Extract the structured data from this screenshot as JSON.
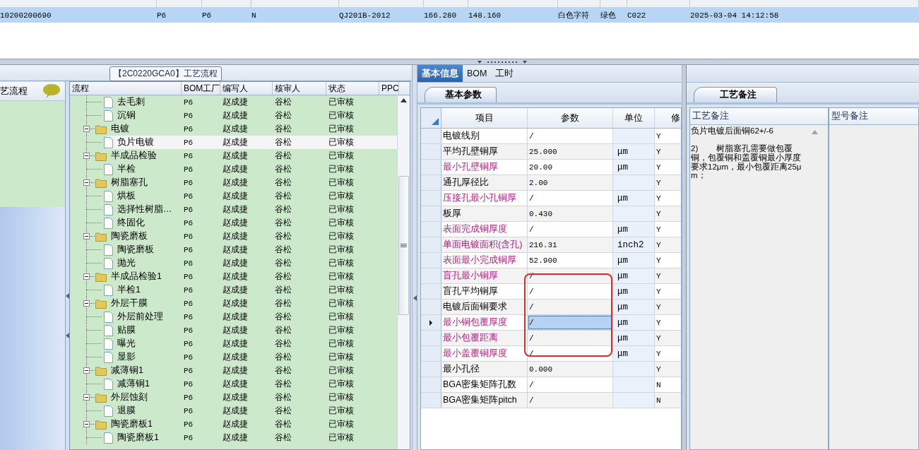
{
  "top_table": {
    "rows": [
      {
        "selected": true,
        "cells": [
          "10200200690",
          "P6",
          "P6",
          "N",
          "QJ201B-2012",
          "166.280",
          "148.160",
          "白色字符",
          "绿色",
          "C022",
          "2025-03-04 14:12:58"
        ]
      }
    ]
  },
  "sidebar": {
    "title": "艺流程"
  },
  "process_group": {
    "title": "【2C0220GCA0】工艺流程"
  },
  "tree": {
    "columns": [
      "流程",
      "BOM工厂",
      "编写人",
      "核审人",
      "状态",
      "PPC"
    ],
    "items": [
      {
        "children": [
          {
            "label": "去毛刺",
            "kind": "file",
            "selected": false,
            "bom": "P6",
            "author": "赵成捷",
            "reviewer": "谷松",
            "status": "已审核"
          },
          {
            "label": "沉铜",
            "kind": "file",
            "selected": false,
            "bom": "P6",
            "author": "赵成捷",
            "reviewer": "谷松",
            "status": "已审核"
          }
        ]
      },
      {
        "label": "电镀",
        "kind": "folder",
        "expanded": true,
        "selected": false,
        "bom": "P6",
        "author": "赵成捷",
        "reviewer": "谷松",
        "status": "已审核",
        "children": [
          {
            "label": "负片电镀",
            "kind": "file",
            "selected": true,
            "bom": "P6",
            "author": "赵成捷",
            "reviewer": "谷松",
            "status": "已审核"
          }
        ]
      },
      {
        "label": "半成品检验",
        "kind": "folder",
        "expanded": true,
        "selected": false,
        "bom": "P6",
        "author": "赵成捷",
        "reviewer": "谷松",
        "status": "已审核",
        "children": [
          {
            "label": "半检",
            "kind": "file",
            "selected": false,
            "bom": "P6",
            "author": "赵成捷",
            "reviewer": "谷松",
            "status": "已审核"
          }
        ]
      },
      {
        "label": "树脂塞孔",
        "kind": "folder",
        "expanded": true,
        "selected": false,
        "bom": "P6",
        "author": "赵成捷",
        "reviewer": "谷松",
        "status": "已审核",
        "children": [
          {
            "label": "烘板",
            "kind": "file",
            "selected": false,
            "bom": "P6",
            "author": "赵成捷",
            "reviewer": "谷松",
            "status": "已审核"
          },
          {
            "label": "选择性树脂…",
            "kind": "file",
            "selected": false,
            "bom": "P6",
            "author": "赵成捷",
            "reviewer": "谷松",
            "status": "已审核"
          },
          {
            "label": "终固化",
            "kind": "file",
            "selected": false,
            "bom": "P6",
            "author": "赵成捷",
            "reviewer": "谷松",
            "status": "已审核"
          }
        ]
      },
      {
        "label": "陶瓷磨板",
        "kind": "folder",
        "expanded": true,
        "selected": false,
        "bom": "P6",
        "author": "赵成捷",
        "reviewer": "谷松",
        "status": "已审核",
        "children": [
          {
            "label": "陶瓷磨板",
            "kind": "file",
            "selected": false,
            "bom": "P6",
            "author": "赵成捷",
            "reviewer": "谷松",
            "status": "已审核"
          },
          {
            "label": "抛光",
            "kind": "file",
            "selected": false,
            "bom": "P6",
            "author": "赵成捷",
            "reviewer": "谷松",
            "status": "已审核"
          }
        ]
      },
      {
        "label": "半成品检验1",
        "kind": "folder",
        "expanded": true,
        "selected": false,
        "bom": "P6",
        "author": "赵成捷",
        "reviewer": "谷松",
        "status": "已审核",
        "children": [
          {
            "label": "半检1",
            "kind": "file",
            "selected": false,
            "bom": "P6",
            "author": "赵成捷",
            "reviewer": "谷松",
            "status": "已审核"
          }
        ]
      },
      {
        "label": "外层干膜",
        "kind": "folder",
        "expanded": true,
        "selected": false,
        "bom": "P6",
        "author": "赵成捷",
        "reviewer": "谷松",
        "status": "已审核",
        "children": [
          {
            "label": "外层前处理",
            "kind": "file",
            "selected": false,
            "bom": "P6",
            "author": "赵成捷",
            "reviewer": "谷松",
            "status": "已审核"
          },
          {
            "label": "贴膜",
            "kind": "file",
            "selected": false,
            "bom": "P6",
            "author": "赵成捷",
            "reviewer": "谷松",
            "status": "已审核"
          },
          {
            "label": "曝光",
            "kind": "file",
            "selected": false,
            "bom": "P6",
            "author": "赵成捷",
            "reviewer": "谷松",
            "status": "已审核"
          },
          {
            "label": "显影",
            "kind": "file",
            "selected": false,
            "bom": "P6",
            "author": "赵成捷",
            "reviewer": "谷松",
            "status": "已审核"
          }
        ]
      },
      {
        "label": "减薄铜1",
        "kind": "folder",
        "expanded": true,
        "selected": false,
        "bom": "P6",
        "author": "赵成捷",
        "reviewer": "谷松",
        "status": "已审核",
        "children": [
          {
            "label": "减薄铜1",
            "kind": "file",
            "selected": false,
            "bom": "P6",
            "author": "赵成捷",
            "reviewer": "谷松",
            "status": "已审核"
          }
        ]
      },
      {
        "label": "外层蚀刻",
        "kind": "folder",
        "expanded": true,
        "selected": false,
        "bom": "P6",
        "author": "赵成捷",
        "reviewer": "谷松",
        "status": "已审核",
        "children": [
          {
            "label": "退膜",
            "kind": "file",
            "selected": false,
            "bom": "P6",
            "author": "赵成捷",
            "reviewer": "谷松",
            "status": "已审核"
          }
        ]
      },
      {
        "label": "陶瓷磨板1",
        "kind": "folder",
        "expanded": true,
        "selected": false,
        "bom": "P6",
        "author": "赵成捷",
        "reviewer": "谷松",
        "status": "已审核",
        "children": [
          {
            "label": "陶瓷磨板1",
            "kind": "file",
            "selected": false,
            "bom": "P6",
            "author": "赵成捷",
            "reviewer": "谷松",
            "status": "已审核"
          }
        ]
      }
    ]
  },
  "main_tabs": [
    {
      "label": "基本信息",
      "selected": true
    },
    {
      "label": "BOM",
      "selected": false
    },
    {
      "label": "工时",
      "selected": false
    }
  ],
  "params": {
    "tab": "基本参数",
    "columns": [
      "项目",
      "参数",
      "单位",
      "修"
    ],
    "rows": [
      {
        "item": "电镀线别",
        "value": "/",
        "modify": "Y",
        "highlighted": false,
        "selected": false
      },
      {
        "item": "平均孔壁铜厚",
        "value": "25.000",
        "unit": "μm",
        "modify": "Y",
        "highlighted": false,
        "selected": false
      },
      {
        "item": "最小孔壁铜厚",
        "value": "20.00",
        "unit": "μm",
        "modify": "Y",
        "highlighted": true,
        "selected": false
      },
      {
        "item": "通孔厚径比",
        "value": "2.00",
        "modify": "Y",
        "highlighted": false,
        "selected": false
      },
      {
        "item": "压接孔最小孔铜厚",
        "value": "/",
        "unit": "μm",
        "modify": "Y",
        "highlighted": true,
        "selected": false
      },
      {
        "item": "板厚",
        "value": "0.430",
        "modify": "Y",
        "highlighted": false,
        "selected": false
      },
      {
        "item": "表面完成铜厚度",
        "value": "/",
        "unit": "μm",
        "modify": "Y",
        "highlighted": true,
        "selected": false
      },
      {
        "item": "单面电镀面积(含孔)",
        "value": "216.31",
        "unit": "inch2",
        "modify": "Y",
        "highlighted": true,
        "selected": false
      },
      {
        "item": "表面最小完成铜厚",
        "value": "52.900",
        "unit": "μm",
        "modify": "Y",
        "highlighted": true,
        "selected": false
      },
      {
        "item": "盲孔最小铜厚",
        "value": "/",
        "unit": "μm",
        "modify": "Y",
        "highlighted": true,
        "selected": false
      },
      {
        "item": "盲孔平均铜厚",
        "value": "/",
        "unit": "μm",
        "modify": "Y",
        "highlighted": false,
        "selected": false
      },
      {
        "item": "电镀后面铜要求",
        "value": "/",
        "unit": "μm",
        "modify": "Y",
        "highlighted": false,
        "selected": false
      },
      {
        "item": "最小铜包覆厚度",
        "value": "/",
        "unit": "μm",
        "modify": "Y",
        "highlighted": true,
        "selected": true
      },
      {
        "item": "最小包覆距离",
        "value": "/",
        "unit": "μm",
        "modify": "Y",
        "highlighted": true,
        "selected": false
      },
      {
        "item": "最小盖覆铜厚度",
        "value": "/",
        "unit": "μm",
        "modify": "Y",
        "highlighted": true,
        "selected": false
      },
      {
        "item": "最小孔径",
        "value": "0.000",
        "modify": "Y",
        "highlighted": false,
        "selected": false
      },
      {
        "item": "BGA密集矩阵孔数",
        "value": "/",
        "modify": "N",
        "highlighted": false,
        "selected": false
      },
      {
        "item": "BGA密集矩阵pitch",
        "value": "/",
        "modify": "N",
        "highlighted": false,
        "selected": false
      }
    ]
  },
  "notes": {
    "tab": "工艺备注",
    "columns": [
      "工艺备注",
      "型号备注"
    ],
    "process_note": "负片电镀后面铜62+/-6\n\n2)        树脂塞孔需要做包覆铜，包覆铜和盖覆铜最小厚度要求12μm，最小包覆距离25μm；"
  }
}
